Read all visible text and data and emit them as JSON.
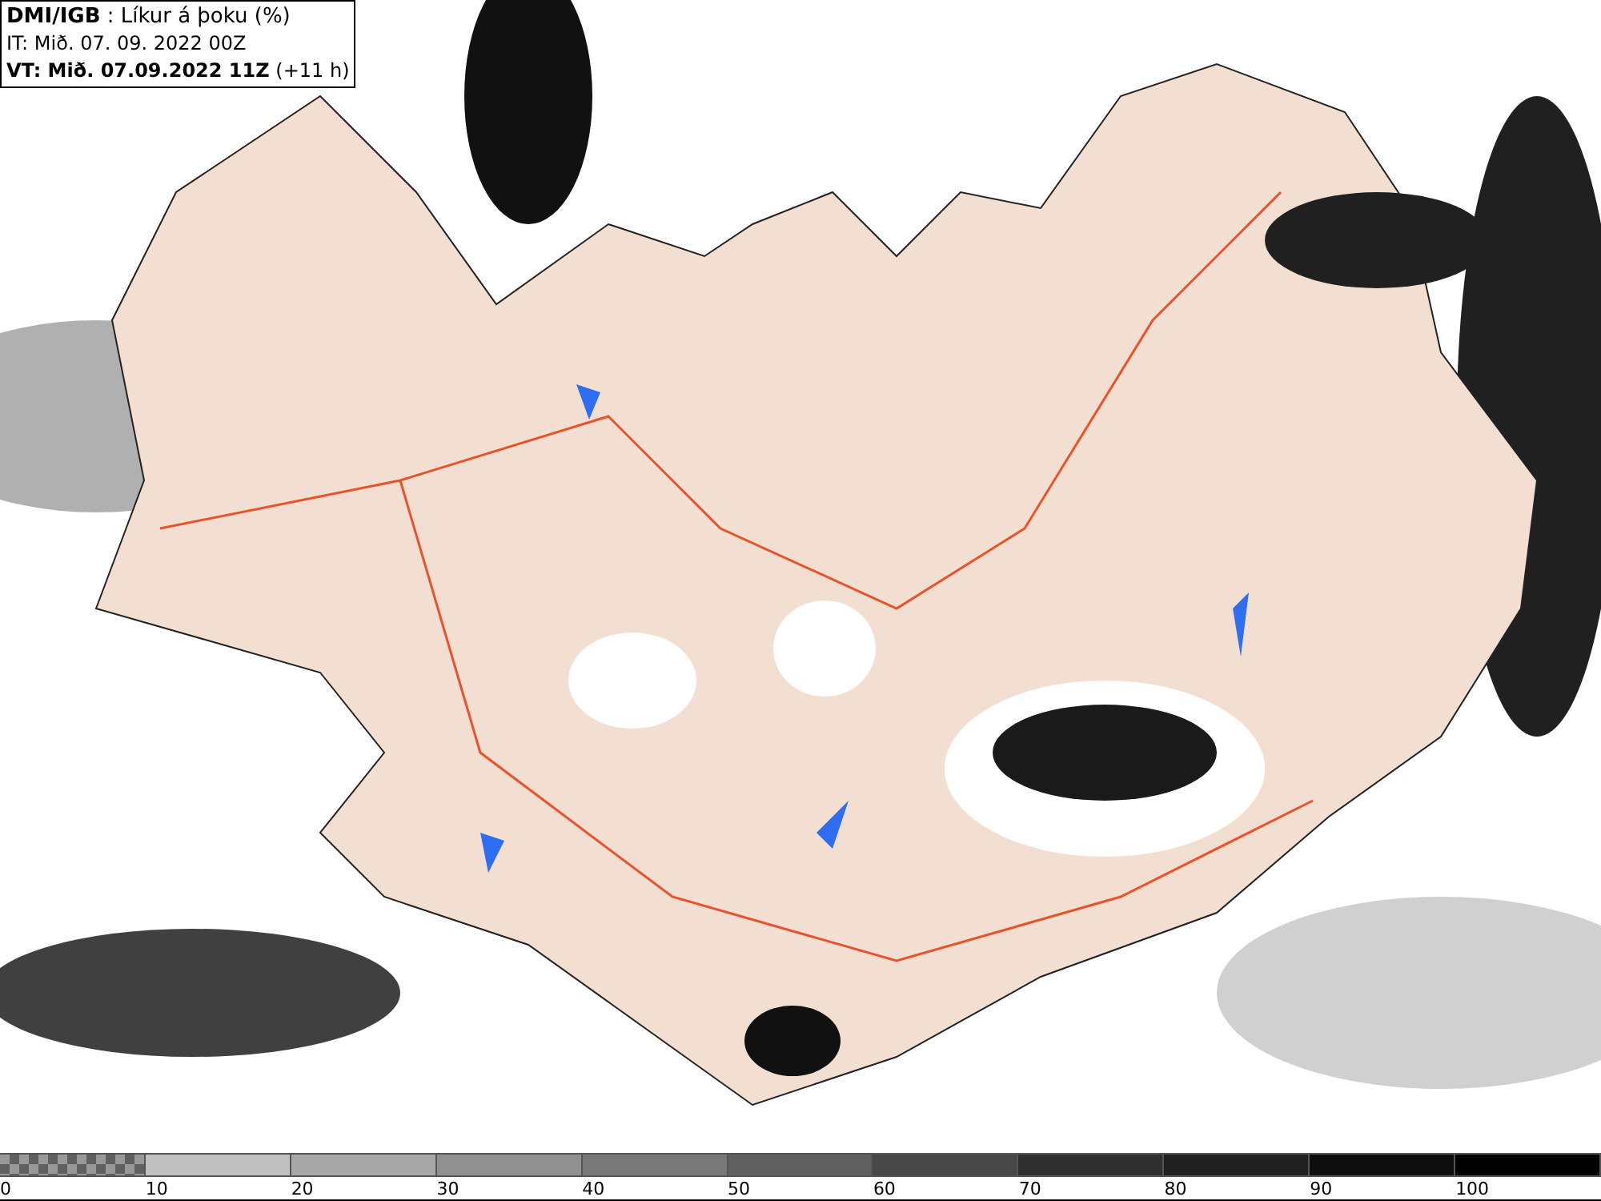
{
  "header": {
    "title": "**DMI/IGB** : Líkur á þoku (%)",
    "issue_time": "IT: Mið. 07. 09. 2022 00Z",
    "valid_time": "**VT: Mið. 07.09.2022 11Z** (+11 h)"
  },
  "legend": {
    "segments": [
      {
        "kind": "checker",
        "color": "#606060"
      },
      {
        "kind": "solid",
        "color": "#c0c0c0"
      },
      {
        "kind": "solid",
        "color": "#a8a8a8"
      },
      {
        "kind": "solid",
        "color": "#909090"
      },
      {
        "kind": "solid",
        "color": "#787878"
      },
      {
        "kind": "solid",
        "color": "#606060"
      },
      {
        "kind": "solid",
        "color": "#484848"
      },
      {
        "kind": "solid",
        "color": "#303030"
      },
      {
        "kind": "solid",
        "color": "#202020"
      },
      {
        "kind": "solid",
        "color": "#0e0e0e"
      },
      {
        "kind": "solid",
        "color": "#000000"
      }
    ],
    "ticks": [
      "0",
      "10",
      "20",
      "30",
      "40",
      "50",
      "60",
      "70",
      "80",
      "90",
      "100"
    ]
  }
}
